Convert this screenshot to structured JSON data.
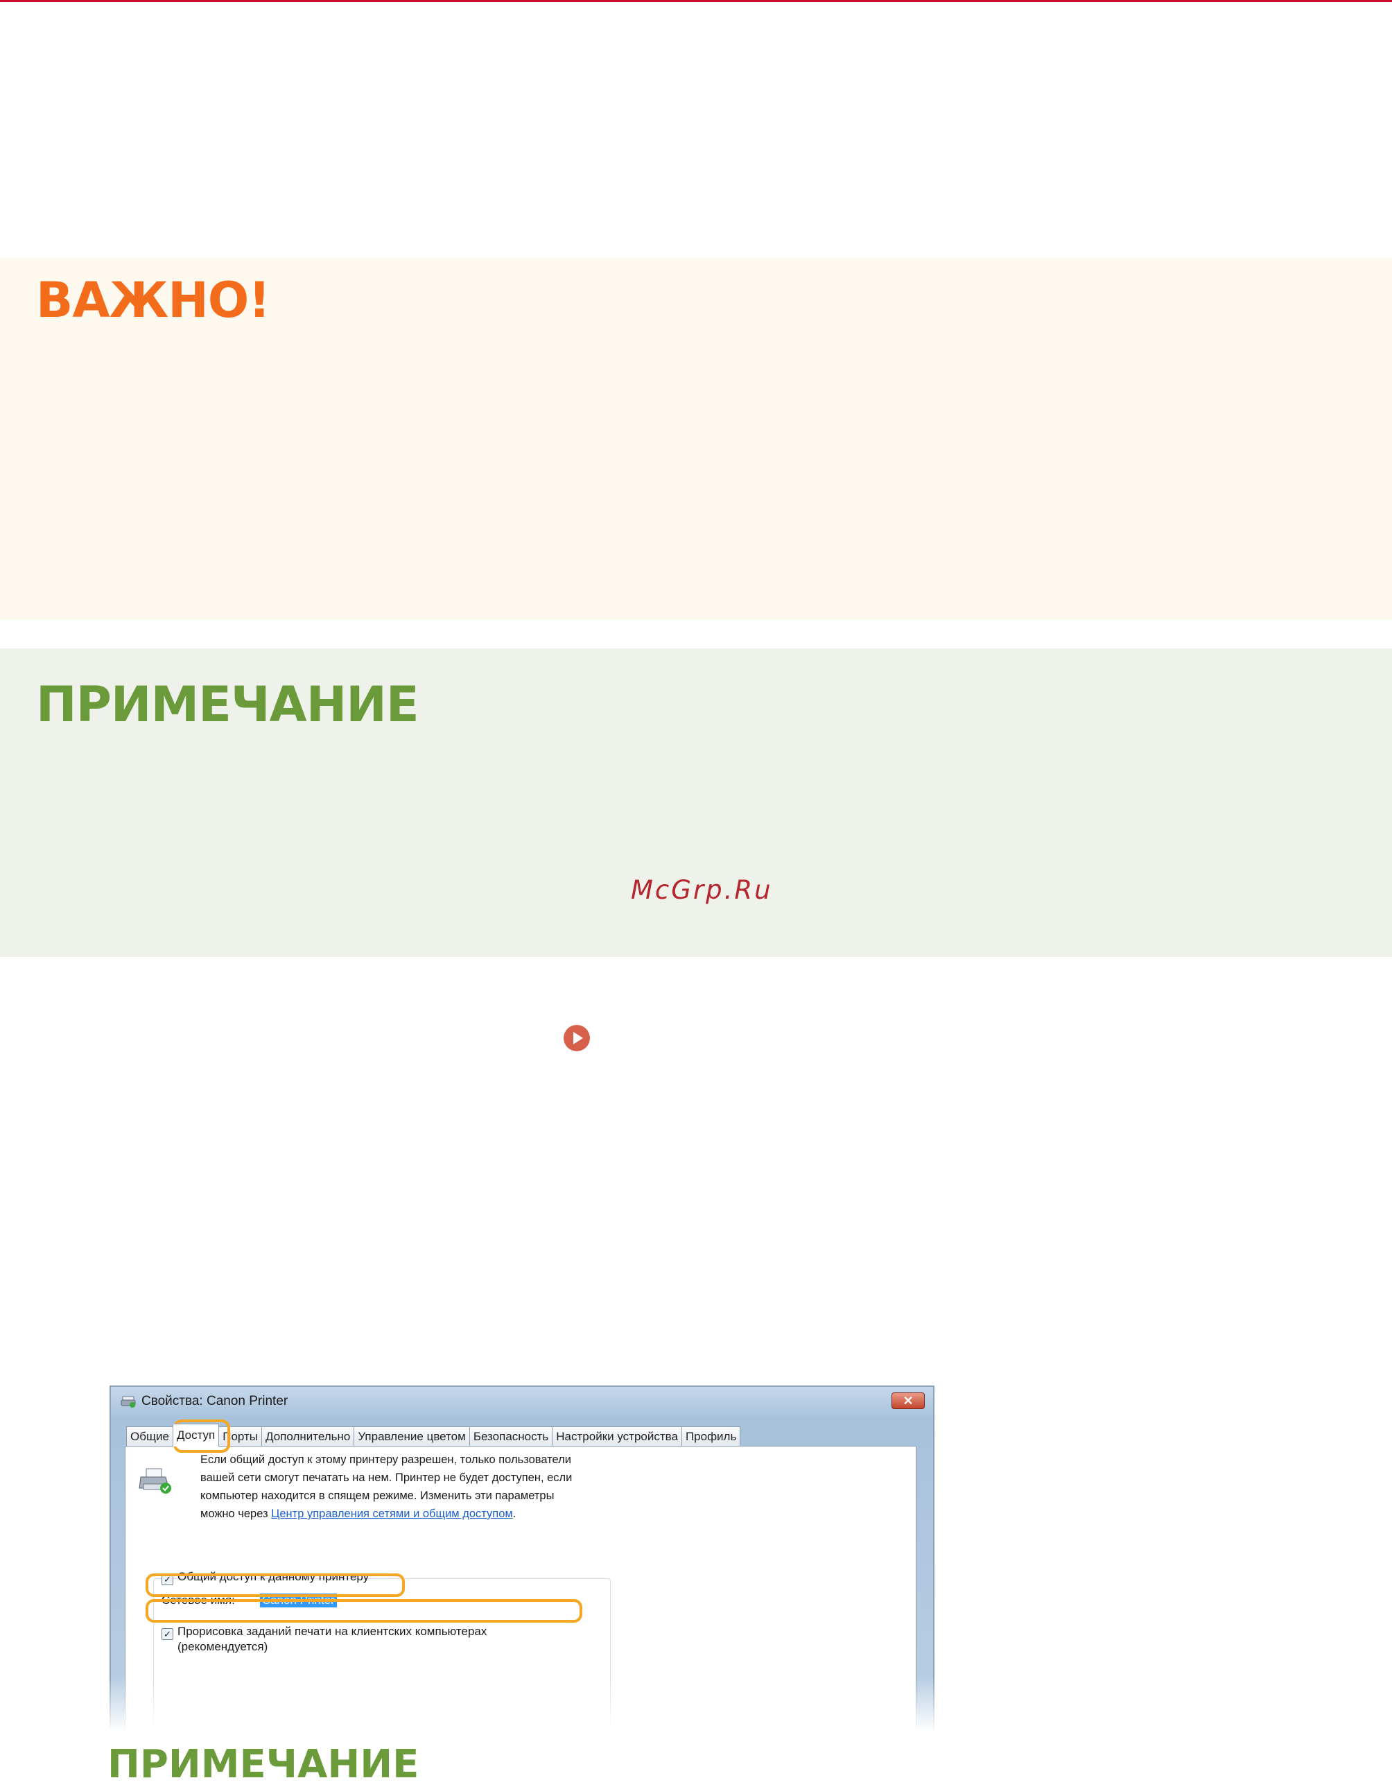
{
  "important": {
    "heading": "ВАЖНО!"
  },
  "note": {
    "heading": "ПРИМЕЧАНИЕ"
  },
  "watermark": "McGrp.Ru",
  "dialog": {
    "title": "Свойства: Canon Printer",
    "close_label": "✕",
    "tabs": [
      "Общие",
      "Доступ",
      "Порты",
      "Дополнительно",
      "Управление цветом",
      "Безопасность",
      "Настройки устройства",
      "Профиль"
    ],
    "active_tab": "Доступ",
    "description": "Если общий доступ к этому принтеру разрешен, только пользователи вашей сети смогут печатать на нем. Принтер не будет доступен, если компьютер находится в спящем режиме. Изменить эти параметры можно через ",
    "description_link": "Центр управления сетями и общим доступом",
    "description_end": ".",
    "share_checkbox": "Общий доступ к данному принтеру",
    "share_name_label": "Сетевое имя:",
    "share_name_value": "Canon Printer",
    "render_checkbox": "Прорисовка заданий печати на клиентских компьютерах (рекомендуется)"
  },
  "note_bottom": {
    "heading": "ПРИМЕЧАНИЕ"
  },
  "colors": {
    "important_heading": "#f26c1c",
    "note_heading": "#6a9a3a",
    "highlight": "#f5a623",
    "top_rule": "#c8102e",
    "watermark": "#b4252e"
  },
  "icons": [
    "play-circle-icon",
    "printer-share-icon",
    "app-icon",
    "close-icon"
  ]
}
